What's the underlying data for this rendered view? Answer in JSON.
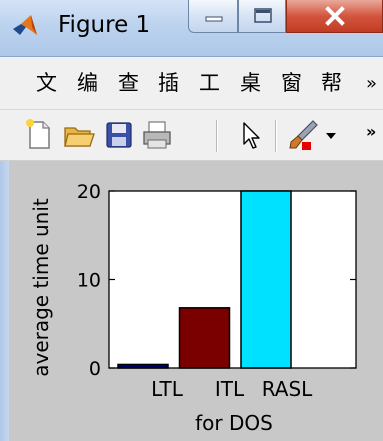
{
  "window": {
    "title": "Figure 1",
    "icon": "matlab-logo-icon"
  },
  "menu": {
    "items": [
      "文",
      "编",
      "查",
      "插",
      "工",
      "桌",
      "窗",
      "帮"
    ],
    "overflow": "»"
  },
  "toolbar": {
    "buttons": [
      "new-figure-icon",
      "open-file-icon",
      "save-icon",
      "print-icon",
      "pointer-icon",
      "brush-icon",
      "dropdown-arrow-icon"
    ],
    "overflow": "»"
  },
  "chart_data": {
    "type": "bar",
    "categories": [
      "LTL",
      "ITL",
      "RASL"
    ],
    "values": [
      0.4,
      6.8,
      20
    ],
    "colors": [
      "#00006a",
      "#7a0000",
      "#00e0ff"
    ],
    "xlabel": "for DOS",
    "ylabel": "average time unit",
    "ylim": [
      0,
      20
    ],
    "yticks": [
      0,
      10,
      20
    ],
    "grid": false
  }
}
